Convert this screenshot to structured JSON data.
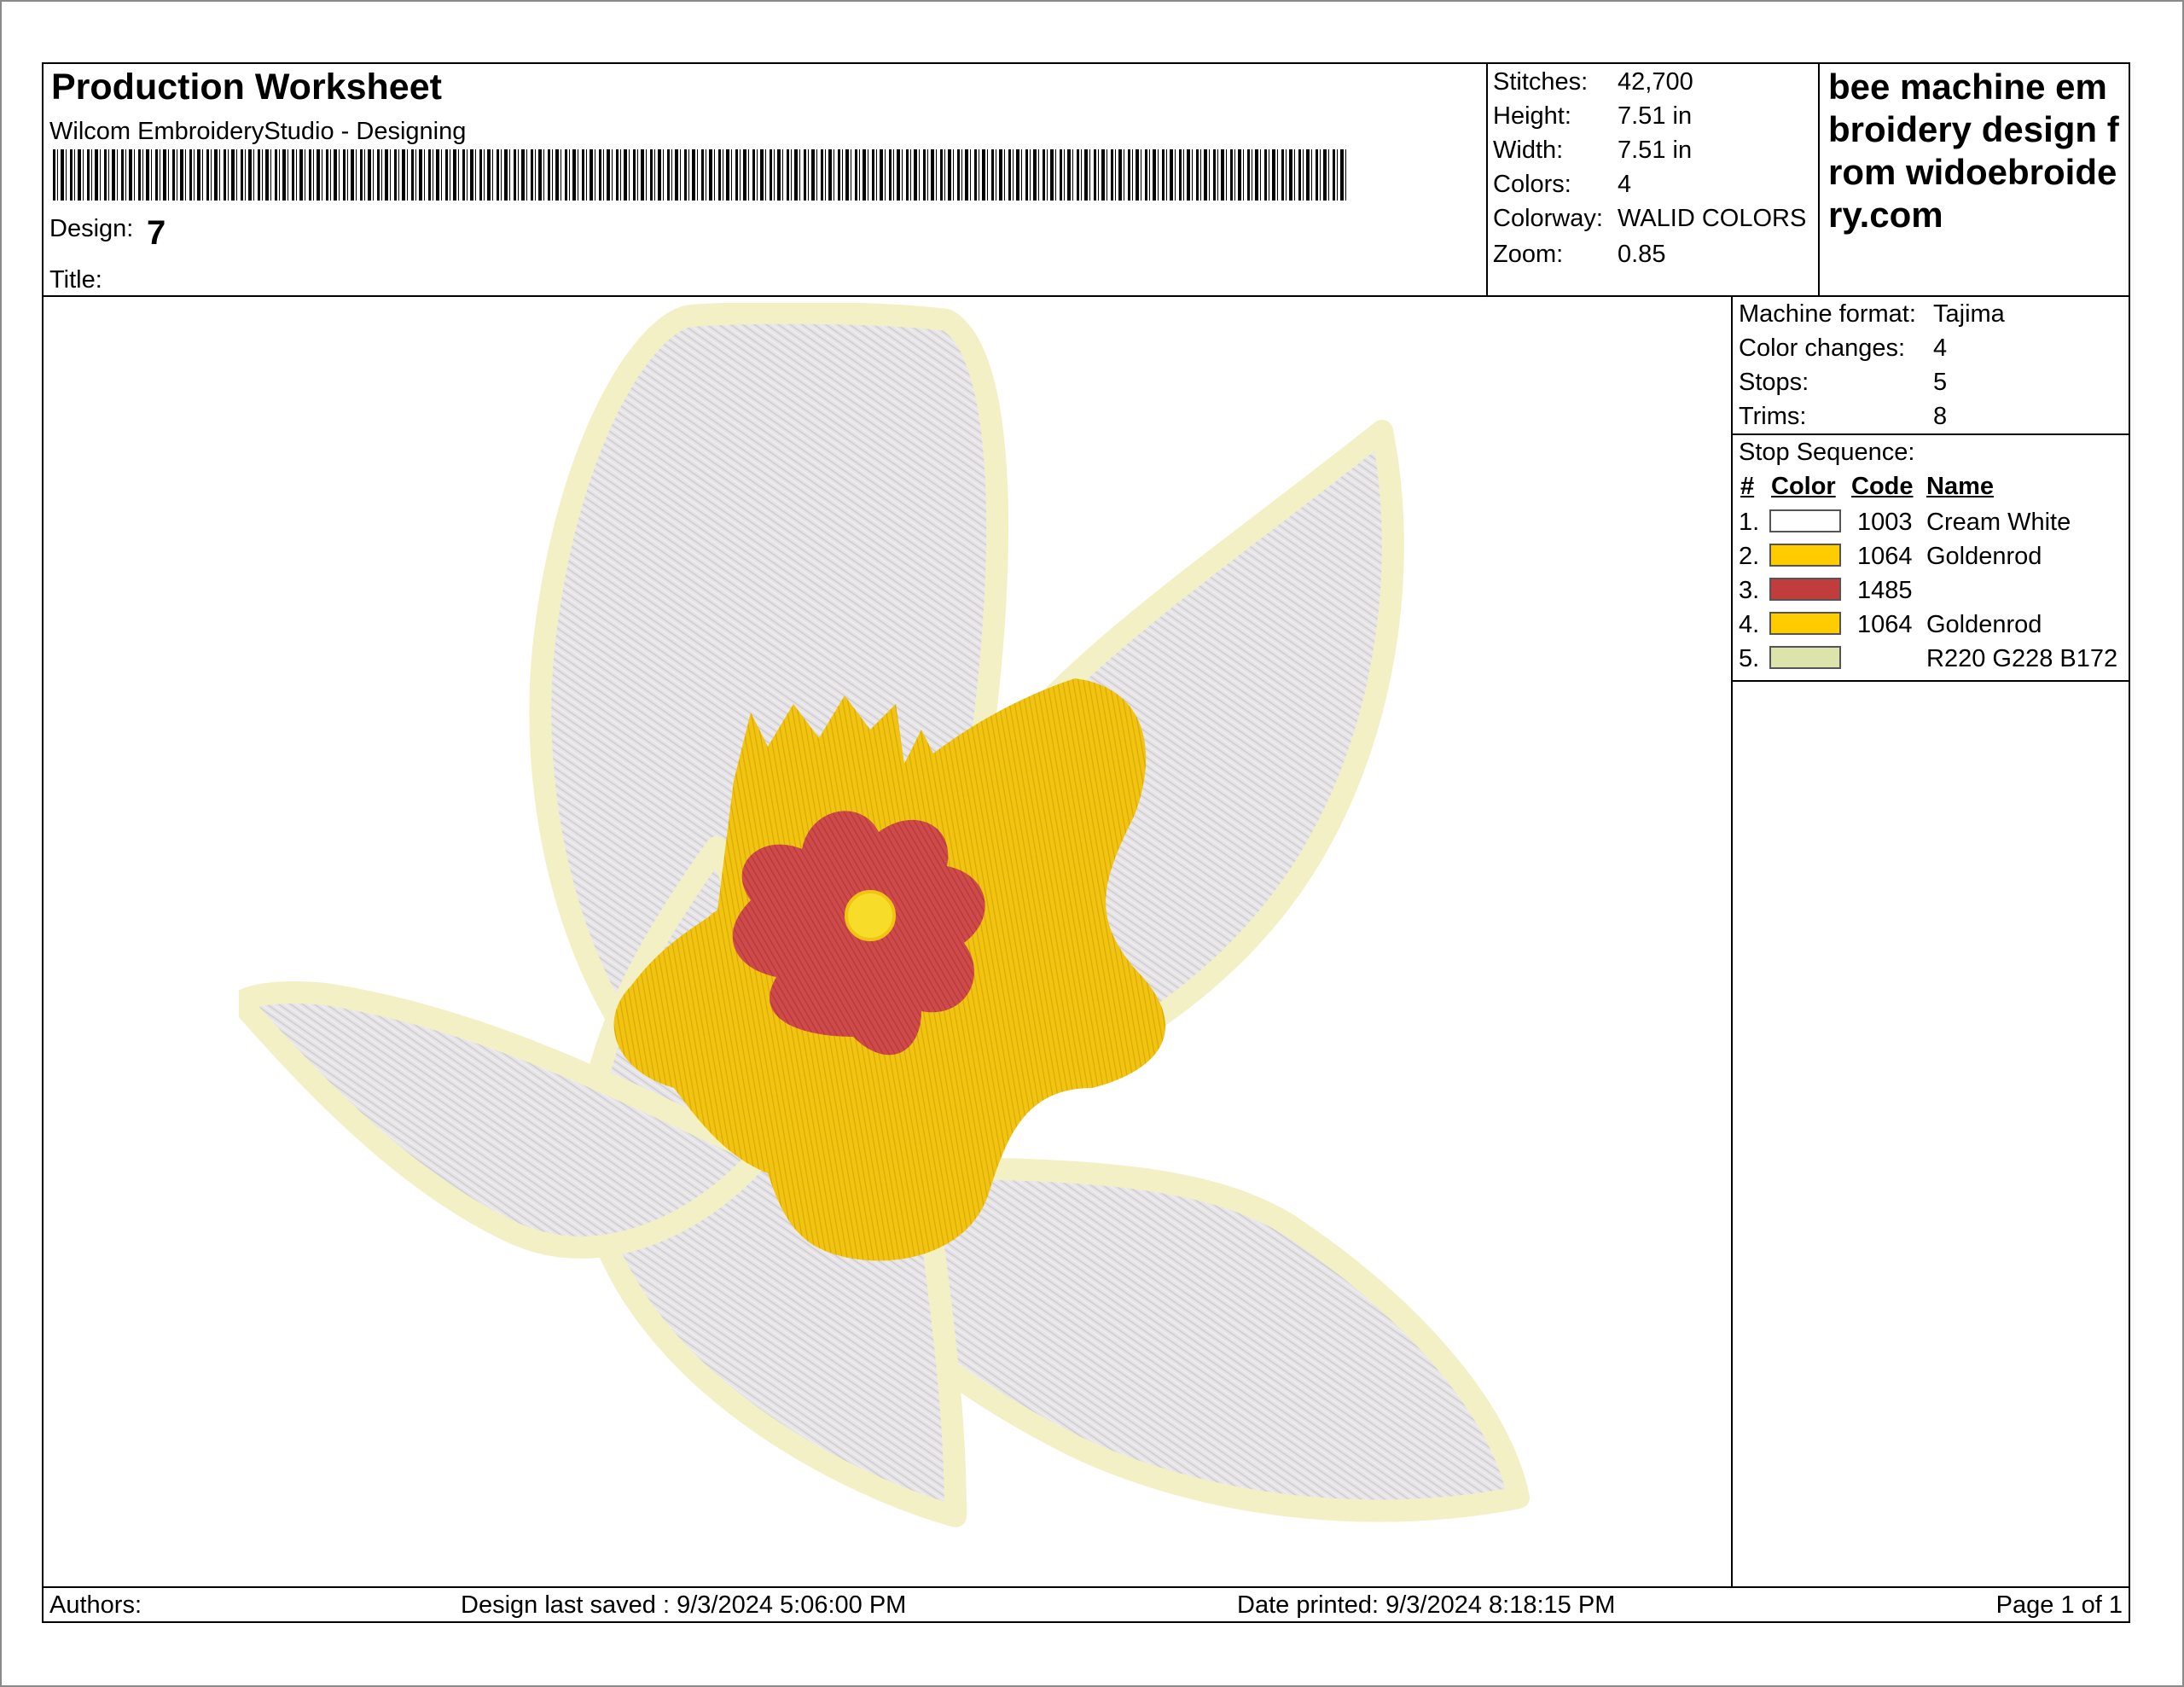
{
  "header": {
    "title": "Production Worksheet",
    "software": "Wilcom EmbroideryStudio - Designing",
    "design_label": "Design:",
    "design_value": "7",
    "title_label": "Title:",
    "title_value": ""
  },
  "stats": [
    {
      "label": "Stitches:",
      "value": "42,700"
    },
    {
      "label": "Height:",
      "value": "7.51 in"
    },
    {
      "label": "Width:",
      "value": "7.51 in"
    },
    {
      "label": "Colors:",
      "value": "4"
    },
    {
      "label": "Colorway:",
      "value": "WALID COLORS"
    },
    {
      "label": "Zoom:",
      "value": "0.85"
    }
  ],
  "brand_text": "bee machine embroidery design from widoebroidery.com",
  "machine": [
    {
      "label": "Machine format:",
      "value": "Tajima"
    },
    {
      "label": "Color changes:",
      "value": "4"
    },
    {
      "label": "Stops:",
      "value": "5"
    },
    {
      "label": "Trims:",
      "value": "8"
    }
  ],
  "stop_sequence": {
    "title": "Stop Sequence:",
    "headers": {
      "num": "#",
      "color": "Color",
      "code": "Code",
      "name": "Name"
    },
    "rows": [
      {
        "num": "1.",
        "color": "#ffffff",
        "code": "1003",
        "name": "Cream White"
      },
      {
        "num": "2.",
        "color": "#ffcc00",
        "code": "1064",
        "name": "Goldenrod"
      },
      {
        "num": "3.",
        "color": "#c13c3c",
        "code": "1485",
        "name": ""
      },
      {
        "num": "4.",
        "color": "#ffcc00",
        "code": "1064",
        "name": "Goldenrod"
      },
      {
        "num": "5.",
        "color": "#dce4ac",
        "code": "",
        "name": "R220 G228 B172"
      }
    ]
  },
  "footer": {
    "authors": "Authors:",
    "saved": "Design last saved : 9/3/2024 5:06:00 PM",
    "printed": "Date printed: 9/3/2024 8:18:15 PM",
    "page": "Page 1 of 1"
  },
  "design_colors": {
    "petal_fill": "#e6e4e6",
    "petal_outline": "#f3f0c6",
    "petal_outline_edge": "#c9c597",
    "gold": "#f2c412",
    "red": "#cf4a4a",
    "center": "#f7dc2a"
  }
}
